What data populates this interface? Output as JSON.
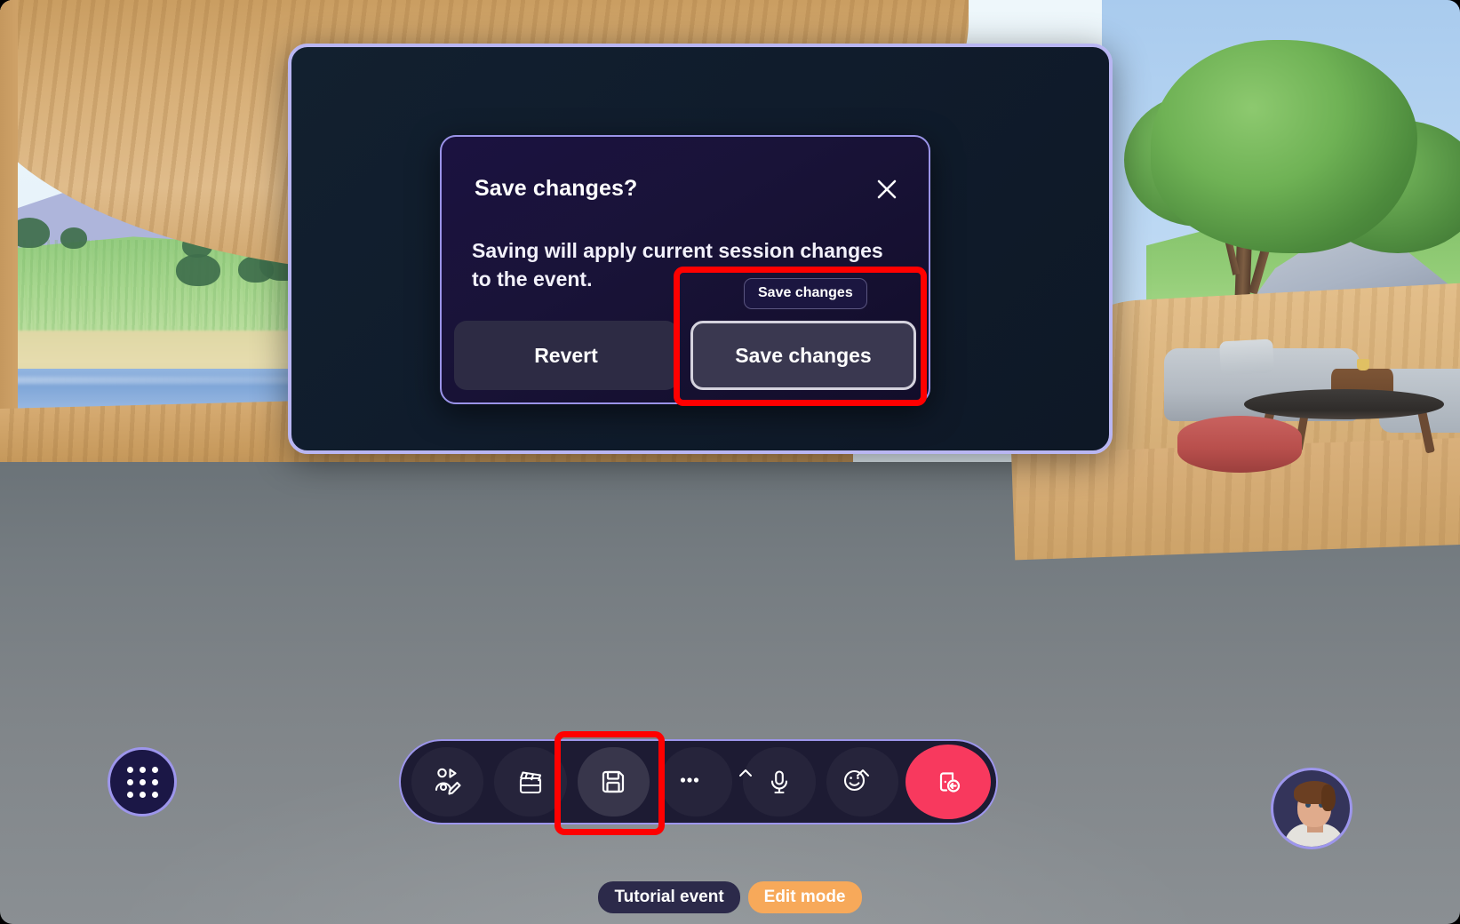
{
  "scene": {
    "description": "virtual-3d-meeting-space"
  },
  "outer_panel": {
    "name": "event-settings-panel"
  },
  "dialog": {
    "title": "Save changes?",
    "body": "Saving will apply current session changes to the event.",
    "close_icon": "close-icon",
    "buttons": {
      "revert": "Revert",
      "save": "Save changes"
    }
  },
  "tooltip": {
    "save_changes": "Save changes"
  },
  "app_grid": {
    "icon": "grid-apps-icon"
  },
  "toolbar": {
    "items": [
      {
        "name": "build-mode-button",
        "icon": "shapes-pencil-icon",
        "active": false,
        "chevron": false
      },
      {
        "name": "scene-clips-button",
        "icon": "clapperboard-icon",
        "active": false,
        "chevron": false
      },
      {
        "name": "save-button",
        "icon": "floppy-disk-icon",
        "active": true,
        "chevron": false
      },
      {
        "name": "more-options-button",
        "icon": "ellipsis-icon",
        "active": false,
        "chevron": true
      },
      {
        "name": "microphone-button",
        "icon": "microphone-icon",
        "active": false,
        "chevron": false
      },
      {
        "name": "reactions-button",
        "icon": "smiley-face-icon",
        "active": false,
        "chevron": true
      }
    ],
    "leave": {
      "name": "leave-button",
      "icon": "leave-door-icon"
    }
  },
  "status": {
    "event_name": "Tutorial event",
    "mode": "Edit mode"
  },
  "avatar": {
    "name": "user-avatar"
  },
  "annotations": {
    "save_button_highlight": "red-highlight-box",
    "toolbar_save_highlight": "red-highlight-box"
  },
  "colors": {
    "accent_purple": "#9d96ec",
    "leave_red": "#f8395e",
    "edit_mode_orange": "#f7a95a",
    "annotation_red": "#ff0000",
    "panel_bg": "#101c2c",
    "dialog_bg": "#191338"
  }
}
